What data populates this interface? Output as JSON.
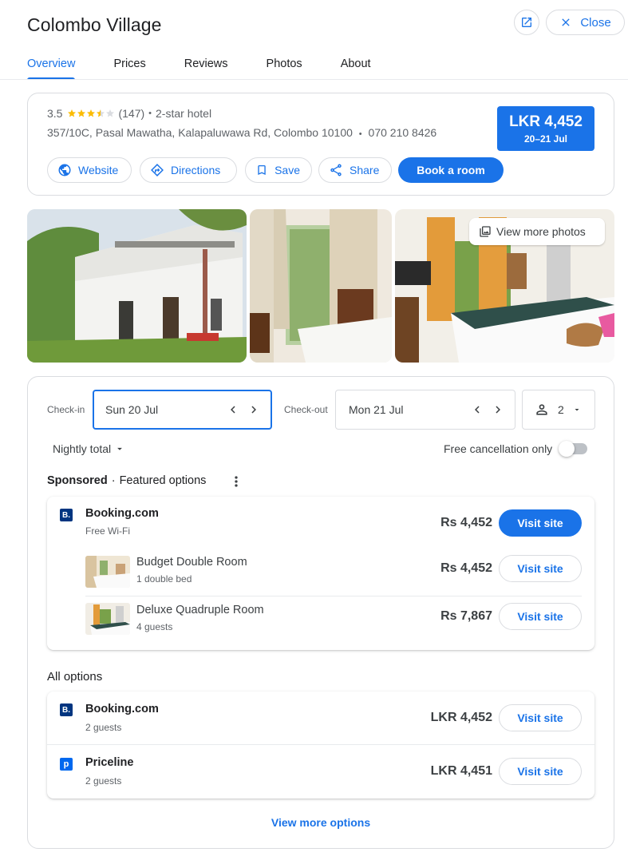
{
  "header": {
    "title": "Colombo Village",
    "open_icon": "open-in-new-icon",
    "close_label": "Close"
  },
  "tabs": [
    {
      "label": "Overview",
      "active": true
    },
    {
      "label": "Prices",
      "active": false
    },
    {
      "label": "Reviews",
      "active": false
    },
    {
      "label": "Photos",
      "active": false
    },
    {
      "label": "About",
      "active": false
    }
  ],
  "summary": {
    "rating": "3.5",
    "stars_value": 3.5,
    "reviews": "(147)",
    "sep": "•",
    "hotel_class": "2-star hotel",
    "address": "357/10C, Pasal Mawatha, Kalapaluwawa Rd, Colombo 10100",
    "phone": "070 210 8426",
    "price": "LKR 4,452",
    "dates": "20–21 Jul",
    "actions": {
      "website": "Website",
      "directions": "Directions",
      "save": "Save",
      "share": "Share",
      "book": "Book a room"
    }
  },
  "photos": {
    "view_more": "View more photos"
  },
  "booking": {
    "checkin_label": "Check-in",
    "checkin_value": "Sun 20 Jul",
    "checkout_label": "Check-out",
    "checkout_value": "Mon 21 Jul",
    "guests": "2",
    "nightly_label": "Nightly total",
    "free_cancel_label": "Free cancellation only",
    "free_cancel_on": false
  },
  "featured": {
    "sponsored": "Sponsored",
    "dot": "·",
    "heading": "Featured options",
    "provider": "Booking.com",
    "provider_logo": "B.",
    "perk": "Free Wi-Fi",
    "price": "Rs 4,452",
    "visit": "Visit site",
    "rooms": [
      {
        "name": "Budget Double Room",
        "detail": "1 double bed",
        "price": "Rs 4,452",
        "visit": "Visit site"
      },
      {
        "name": "Deluxe Quadruple Room",
        "detail": "4 guests",
        "price": "Rs 7,867",
        "visit": "Visit site"
      }
    ]
  },
  "all_options": {
    "heading": "All options",
    "items": [
      {
        "name": "Booking.com",
        "logo": "B.",
        "detail": "2 guests",
        "price": "LKR 4,452",
        "visit": "Visit site"
      },
      {
        "name": "Priceline",
        "logo": "p",
        "detail": "2 guests",
        "price": "LKR 4,451",
        "visit": "Visit site"
      }
    ],
    "more": "View more options"
  },
  "colors": {
    "accent": "#1a73e8",
    "star": "#fbbc04",
    "booking_brand": "#003580",
    "priceline_brand": "#0068ef"
  }
}
